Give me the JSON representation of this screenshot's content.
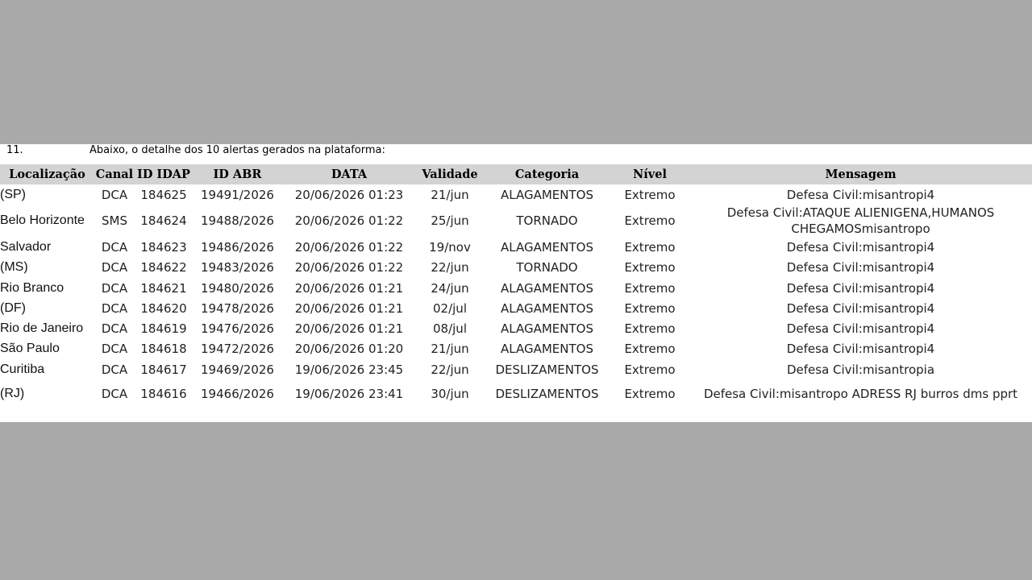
{
  "caption": {
    "number": "11.",
    "text": "Abaixo, o detalhe dos 10 alertas gerados na plataforma:"
  },
  "table": {
    "headers": [
      "Localização",
      "Canal",
      "ID IDAP",
      "ID ABR",
      "DATA",
      "Validade",
      "Categoria",
      "Nível",
      "Mensagem"
    ],
    "rows": [
      [
        "(SP)",
        "DCA",
        "184625",
        "19491/2026",
        "20/06/2026 01:23",
        "21/jun",
        "ALAGAMENTOS",
        "Extremo",
        "Defesa Civil:misantropi4"
      ],
      [
        "Belo Horizonte",
        "SMS",
        "184624",
        "19488/2026",
        "20/06/2026 01:22",
        "25/jun",
        "TORNADO",
        "Extremo",
        "Defesa Civil:ATAQUE ALIENIGENA,HUMANOS CHEGAMOSmisantropo"
      ],
      [
        "Salvador",
        "DCA",
        "184623",
        "19486/2026",
        "20/06/2026 01:22",
        "19/nov",
        "ALAGAMENTOS",
        "Extremo",
        "Defesa Civil:misantropi4"
      ],
      [
        "(MS)",
        "DCA",
        "184622",
        "19483/2026",
        "20/06/2026 01:22",
        "22/jun",
        "TORNADO",
        "Extremo",
        "Defesa Civil:misantropi4"
      ],
      [
        "Rio Branco",
        "DCA",
        "184621",
        "19480/2026",
        "20/06/2026 01:21",
        "24/jun",
        "ALAGAMENTOS",
        "Extremo",
        "Defesa Civil:misantropi4"
      ],
      [
        "(DF)",
        "DCA",
        "184620",
        "19478/2026",
        "20/06/2026 01:21",
        "02/jul",
        "ALAGAMENTOS",
        "Extremo",
        "Defesa Civil:misantropi4"
      ],
      [
        "Rio de Janeiro",
        "DCA",
        "184619",
        "19476/2026",
        "20/06/2026 01:21",
        "08/jul",
        "ALAGAMENTOS",
        "Extremo",
        "Defesa Civil:misantropi4"
      ],
      [
        "São Paulo",
        "DCA",
        "184618",
        "19472/2026",
        "20/06/2026 01:20",
        "21/jun",
        "ALAGAMENTOS",
        "Extremo",
        "Defesa Civil:misantropi4"
      ],
      [
        "Curitiba",
        "DCA",
        "184617",
        "19469/2026",
        "19/06/2026 23:45",
        "22/jun",
        "DESLIZAMENTOS",
        "Extremo",
        "Defesa Civil:misantropia"
      ],
      [
        "(RJ)",
        "DCA",
        "184616",
        "19466/2026",
        "19/06/2026 23:41",
        "30/jun",
        "DESLIZAMENTOS",
        "Extremo",
        "Defesa Civil:misantropo ADRESS RJ burros dms pprt"
      ]
    ]
  },
  "colors": {
    "page_background": "#a9a9a9",
    "document_background": "#ffffff",
    "header_row_background": "#d3d3d3"
  }
}
